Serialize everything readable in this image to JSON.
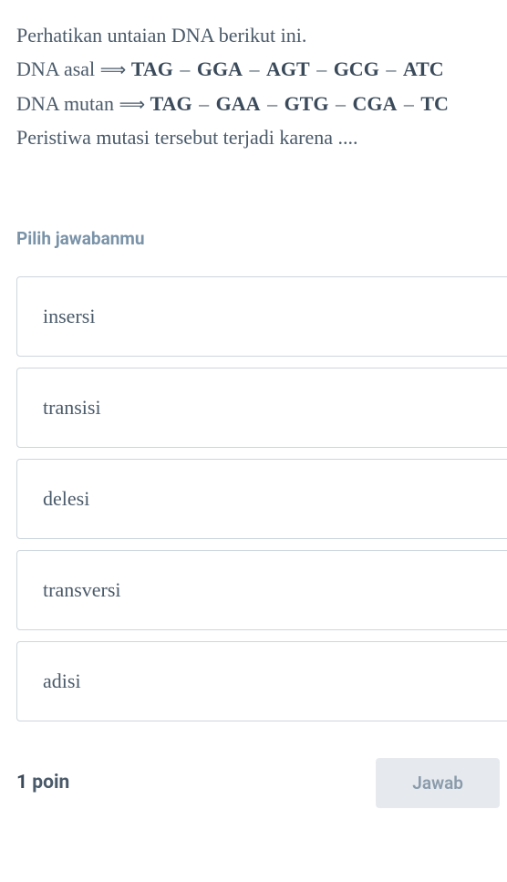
{
  "question": {
    "intro": "Perhatikan untaian DNA berikut ini.",
    "dna_original_label": "DNA asal",
    "dna_mutant_label": "DNA mutan",
    "arrow": "⟹",
    "seq_original": [
      "TAG",
      "GGA",
      "AGT",
      "GCG",
      "ATC"
    ],
    "seq_mutant": [
      "TAG",
      "GAA",
      "GTG",
      "CGA",
      "TC"
    ],
    "separator": "–",
    "closing": "Peristiwa mutasi tersebut terjadi karena ...."
  },
  "choose_label": "Pilih jawabanmu",
  "options": [
    {
      "label": "insersi"
    },
    {
      "label": "transisi"
    },
    {
      "label": "delesi"
    },
    {
      "label": "transversi"
    },
    {
      "label": "adisi"
    }
  ],
  "footer": {
    "points_value": "1",
    "points_unit": "poin",
    "submit_label": "Jawab"
  }
}
